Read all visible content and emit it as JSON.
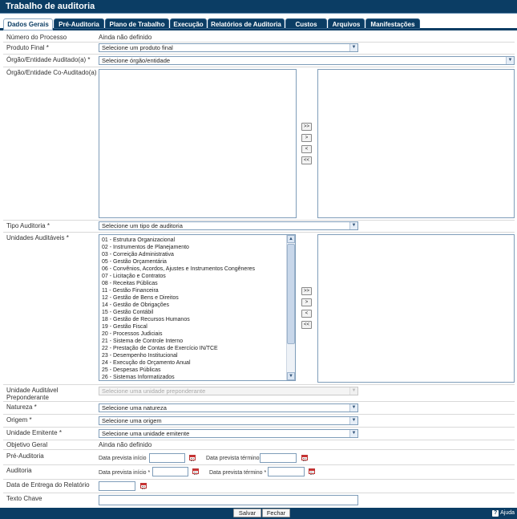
{
  "window": {
    "title": "Trabalho de auditoria"
  },
  "tabs": [
    {
      "label": "Dados Gerais",
      "active": true
    },
    {
      "label": "Pré-Auditoria"
    },
    {
      "label": "Plano de Trabalho"
    },
    {
      "label": "Execução"
    },
    {
      "label": "Relatórios de Auditoria"
    },
    {
      "label": "Custos"
    },
    {
      "label": "Arquivos"
    },
    {
      "label": "Manifestações"
    }
  ],
  "fields": {
    "numero_processo": {
      "label": "Número do Processo",
      "value": "Ainda não definido"
    },
    "produto_final": {
      "label": "Produto Final *",
      "selected": "Selecione um produto final"
    },
    "orgao": {
      "label": "Órgão/Entidade Auditado(a) *",
      "selected": "Selecione órgão/entidade"
    },
    "co_auditado": {
      "label": "Órgão/Entidade Co-Auditado(a)"
    },
    "tipo_auditoria": {
      "label": "Tipo Auditoria *",
      "selected": "Selecione um tipo de auditoria"
    },
    "unidades": {
      "label": "Unidades Auditáveis *",
      "items": [
        "01 - Estrutura Organizacional",
        "02 - Instrumentos de Planejamento",
        "03 - Correição Administrativa",
        "05 - Gestão Orçamentária",
        "06 - Convênios, Acordos, Ajustes e Instrumentos Congêneres",
        "07 - Licitação e Contratos",
        "08 - Receitas Públicas",
        "11 - Gestão Financeira",
        "12 - Gestão de Bens e Direitos",
        "14 - Gestão de Obrigações",
        "15 - Gestão Contábil",
        "18 - Gestão de Recursos Humanos",
        "19 - Gestão Fiscal",
        "20 - Processos Judiciais",
        "21 - Sistema de Controle Interno",
        "22 - Prestação de Contas de Exercício IN/TCE",
        "23 - Desempenho Institucional",
        "24 - Execução do Orçamento Anual",
        "25 - Despesas Públicas",
        "26 - Sistemas Informatizados"
      ]
    },
    "preponderante": {
      "label": "Unidade Auditável Preponderante",
      "selected": "Selecione uma unidade preponderante"
    },
    "natureza": {
      "label": "Natureza *",
      "selected": "Selecione uma natureza"
    },
    "origem": {
      "label": "Origem *",
      "selected": "Selecione uma origem"
    },
    "emitente": {
      "label": "Unidade Emitente *",
      "selected": "Selecione uma unidade emitente"
    },
    "objetivo": {
      "label": "Objetivo Geral",
      "value": "Ainda não definido"
    },
    "pre_auditoria": {
      "label": "Pré-Auditoria",
      "inicio": "Data prevista início",
      "termino": "Data prevista término"
    },
    "auditoria": {
      "label": "Auditoria",
      "inicio": "Data prevista início *",
      "termino": "Data prevista término *"
    },
    "entrega": {
      "label": "Data de Entrega do Relatório"
    },
    "texto_chave": {
      "label": "Texto Chave"
    }
  },
  "move_buttons": [
    ">>",
    ">",
    "<",
    "<<"
  ],
  "footer": {
    "save": "Salvar",
    "close": "Fechar",
    "help": "Ajuda"
  },
  "icons": {
    "dropdown": "chevron-down-icon",
    "calendar": "calendar-icon",
    "help": "help-icon"
  },
  "colors": {
    "header": "#0b3d64",
    "tab": "#0b3d64",
    "field_border": "#7f9db9"
  }
}
